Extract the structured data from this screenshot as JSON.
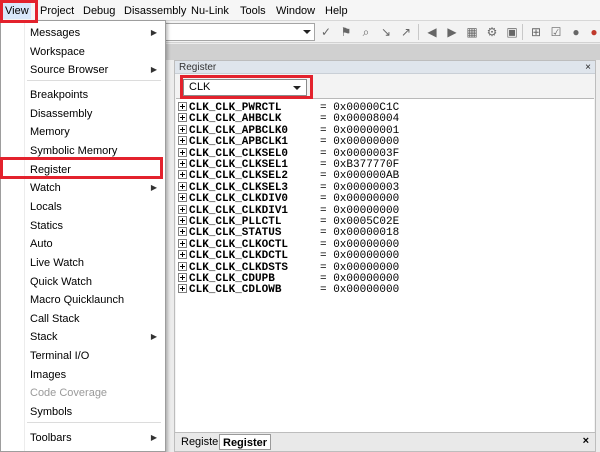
{
  "menubar": {
    "items": [
      "View",
      "Project",
      "Debug",
      "Disassembly",
      "Nu-Link",
      "Tools",
      "Window",
      "Help"
    ]
  },
  "view_menu": {
    "items": [
      {
        "label": "Messages",
        "submenu": true,
        "disabled": false
      },
      {
        "label": "Workspace",
        "submenu": false,
        "disabled": false
      },
      {
        "label": "Source Browser",
        "submenu": true,
        "disabled": false
      },
      {
        "label": "Breakpoints",
        "submenu": false,
        "disabled": false
      },
      {
        "label": "Disassembly",
        "submenu": false,
        "disabled": false
      },
      {
        "label": "Memory",
        "submenu": false,
        "disabled": false
      },
      {
        "label": "Symbolic Memory",
        "submenu": false,
        "disabled": false
      },
      {
        "label": "Register",
        "submenu": false,
        "disabled": false
      },
      {
        "label": "Watch",
        "submenu": true,
        "disabled": false
      },
      {
        "label": "Locals",
        "submenu": false,
        "disabled": false
      },
      {
        "label": "Statics",
        "submenu": false,
        "disabled": false
      },
      {
        "label": "Auto",
        "submenu": false,
        "disabled": false
      },
      {
        "label": "Live Watch",
        "submenu": false,
        "disabled": false
      },
      {
        "label": "Quick Watch",
        "submenu": false,
        "disabled": false
      },
      {
        "label": "Macro Quicklaunch",
        "submenu": false,
        "disabled": false
      },
      {
        "label": "Call Stack",
        "submenu": false,
        "disabled": false
      },
      {
        "label": "Stack",
        "submenu": true,
        "disabled": false
      },
      {
        "label": "Terminal I/O",
        "submenu": false,
        "disabled": false
      },
      {
        "label": "Images",
        "submenu": false,
        "disabled": false
      },
      {
        "label": "Code Coverage",
        "submenu": false,
        "disabled": true
      },
      {
        "label": "Symbols",
        "submenu": false,
        "disabled": false
      },
      {
        "label": "Toolbars",
        "submenu": true,
        "disabled": false
      }
    ]
  },
  "register_pane": {
    "title": "Register",
    "group_selected": "CLK",
    "registers": [
      {
        "name": "CLK_CLK_PWRCTL",
        "value": "= 0x00000C1C"
      },
      {
        "name": "CLK_CLK_AHBCLK",
        "value": "= 0x00008004"
      },
      {
        "name": "CLK_CLK_APBCLK0",
        "value": "= 0x00000001"
      },
      {
        "name": "CLK_CLK_APBCLK1",
        "value": "= 0x00000000"
      },
      {
        "name": "CLK_CLK_CLKSEL0",
        "value": "= 0x0000003F"
      },
      {
        "name": "CLK_CLK_CLKSEL1",
        "value": "= 0xB377770F"
      },
      {
        "name": "CLK_CLK_CLKSEL2",
        "value": "= 0x000000AB"
      },
      {
        "name": "CLK_CLK_CLKSEL3",
        "value": "= 0x00000003"
      },
      {
        "name": "CLK_CLK_CLKDIV0",
        "value": "= 0x00000000"
      },
      {
        "name": "CLK_CLK_CLKDIV1",
        "value": "= 0x00000000"
      },
      {
        "name": "CLK_CLK_PLLCTL",
        "value": "= 0x0005C02E"
      },
      {
        "name": "CLK_CLK_STATUS",
        "value": "= 0x00000018"
      },
      {
        "name": "CLK_CLK_CLKOCTL",
        "value": "= 0x00000000"
      },
      {
        "name": "CLK_CLK_CLKDCTL",
        "value": "= 0x00000000"
      },
      {
        "name": "CLK_CLK_CLKDSTS",
        "value": "= 0x00000000"
      },
      {
        "name": "CLK_CLK_CDUPB",
        "value": "= 0x00000000"
      },
      {
        "name": "CLK_CLK_CDLOWB",
        "value": "= 0x00000000"
      }
    ],
    "bottom_tabs": [
      "Register",
      "Register"
    ],
    "active_tab_index": 1
  },
  "colors": {
    "highlight": "#e3222d",
    "menu_hover": "#d9e8fb"
  }
}
